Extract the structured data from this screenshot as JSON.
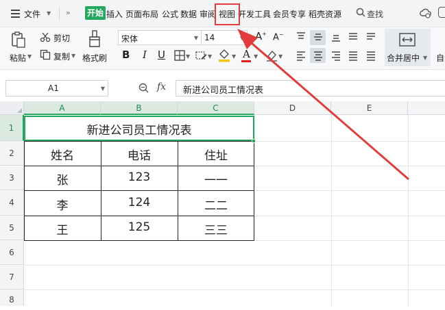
{
  "menubar": {
    "file_label": "文件",
    "tabs": [
      {
        "label": "开始",
        "active": true
      },
      {
        "label": "插入"
      },
      {
        "label": "页面布局"
      },
      {
        "label": "公式"
      },
      {
        "label": "数据"
      },
      {
        "label": "审阅"
      },
      {
        "label": "视图",
        "highlighted": true
      },
      {
        "label": "开发工具"
      },
      {
        "label": "会员专享"
      },
      {
        "label": "稻壳资源"
      }
    ],
    "search_label": "查找"
  },
  "ribbon": {
    "paste_label": "粘贴",
    "cut_label": "剪切",
    "copy_label": "复制",
    "format_painter_label": "格式刷",
    "font_name": "宋体",
    "font_size": "14",
    "bold": "B",
    "italic": "I",
    "underline": "U",
    "merge_label": "合并居中",
    "auto_label": "自动"
  },
  "formula_bar": {
    "cell_ref": "A1",
    "fx": "fx",
    "content": "新进公司员工情况表"
  },
  "sheet": {
    "columns": [
      "A",
      "B",
      "C",
      "D",
      "E"
    ],
    "rows": [
      "1",
      "2",
      "3",
      "4",
      "5",
      "6",
      "7",
      "8"
    ],
    "title": "新进公司员工情况表",
    "headers": [
      "姓名",
      "电话",
      "住址"
    ],
    "data": [
      [
        "张",
        "123",
        "一一"
      ],
      [
        "李",
        "124",
        "二二"
      ],
      [
        "王",
        "125",
        "三三"
      ]
    ]
  },
  "colors": {
    "accent": "#24a860",
    "annotation": "#e23b3b"
  }
}
